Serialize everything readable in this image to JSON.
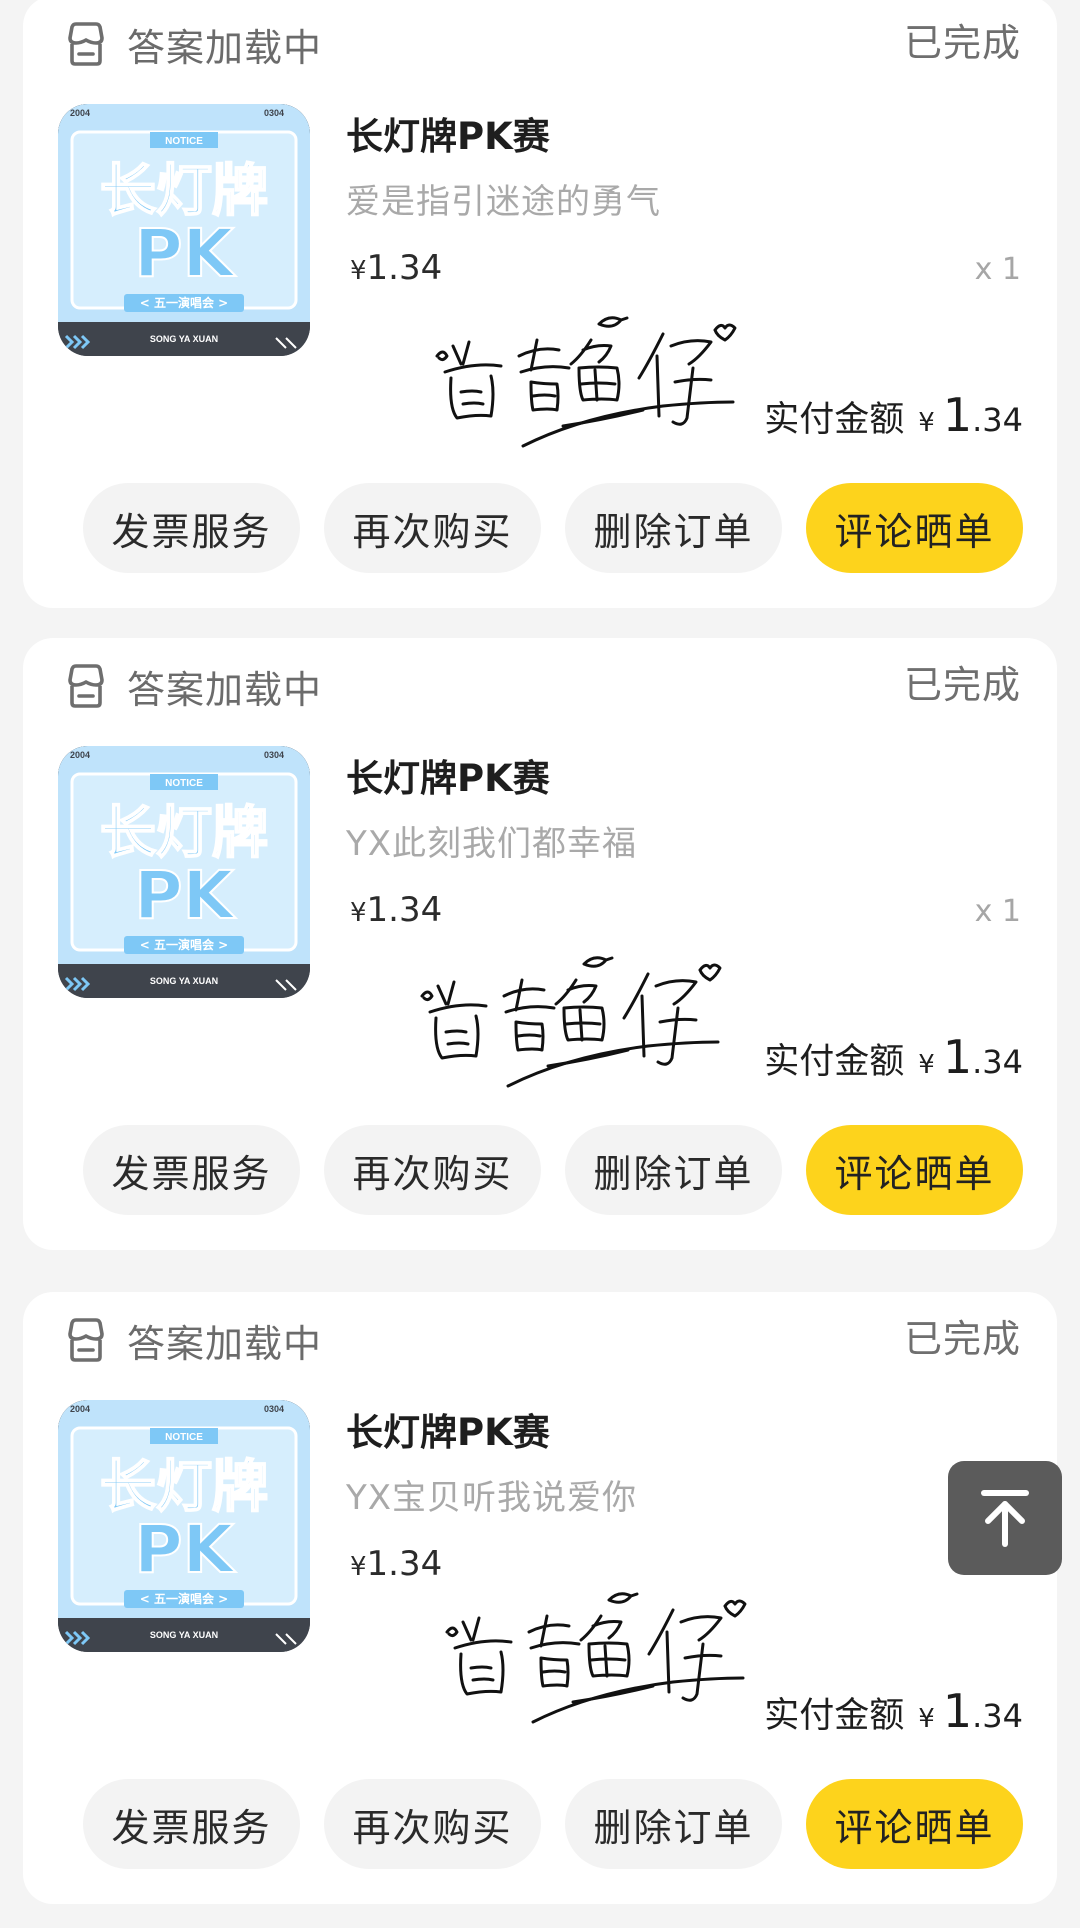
{
  "orders": [
    {
      "shop_name": "答案加载中",
      "status": "已完成",
      "title": "长灯牌PK赛",
      "spec": "爱是指引迷途的勇气",
      "unit_price_symbol": "¥",
      "unit_price": "1.34",
      "quantity": "x 1",
      "paid_label": "实付金额",
      "paid_symbol": "¥",
      "paid_int": "1",
      "paid_dec": ".34",
      "buttons": [
        "发票服务",
        "再次购买",
        "删除订单",
        "评论晒单"
      ]
    },
    {
      "shop_name": "答案加载中",
      "status": "已完成",
      "title": "长灯牌PK赛",
      "spec": "YX此刻我们都幸福",
      "unit_price_symbol": "¥",
      "unit_price": "1.34",
      "quantity": "x 1",
      "paid_label": "实付金额",
      "paid_symbol": "¥",
      "paid_int": "1",
      "paid_dec": ".34",
      "buttons": [
        "发票服务",
        "再次购买",
        "删除订单",
        "评论晒单"
      ]
    },
    {
      "shop_name": "答案加载中",
      "status": "已完成",
      "title": "长灯牌PK赛",
      "spec": "YX宝贝听我说爱你",
      "unit_price_symbol": "¥",
      "unit_price": "1.34",
      "quantity": "x 1",
      "paid_label": "实付金额",
      "paid_symbol": "¥",
      "paid_int": "1",
      "paid_dec": ".34",
      "buttons": [
        "发票服务",
        "再次购买",
        "删除订单",
        "评论晒单"
      ]
    }
  ],
  "thumbnail": {
    "top_left": "2004",
    "top_right": "0304",
    "badge": "NOTICE",
    "line1": "长灯牌",
    "line2": "PK",
    "ribbon": "< 五一演唱会 >",
    "footer": "SONG YA XUAN"
  },
  "signature_icon": "handwritten-signature-watermark",
  "shop_icon": "store-icon",
  "back_to_top_icon": "arrow-up-to-top-icon",
  "colors": {
    "primary_button": "#fdd31c",
    "secondary_button": "#f3f3f3",
    "page_background": "#f4f4f4",
    "thumbnail_blue": "#bfe3fb",
    "thumbnail_text": "#7ec8f6"
  }
}
